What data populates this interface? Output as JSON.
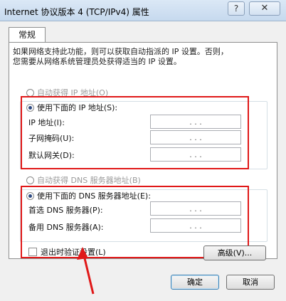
{
  "window": {
    "title": "Internet 协议版本 4 (TCP/IPv4) 属性",
    "help_label": "?",
    "close_label": "✕"
  },
  "tabs": [
    {
      "label": "常规"
    }
  ],
  "description": "如果网络支持此功能，则可以获取自动指派的 IP 设置。否则，\n您需要从网络系统管理员处获得适当的 IP 设置。",
  "ip": {
    "auto_label": "自动获得 IP 地址(O)",
    "manual_label": "使用下面的 IP 地址(S):",
    "selected": "manual",
    "fields": [
      {
        "label": "IP 地址(I):",
        "value": ""
      },
      {
        "label": "子网掩码(U):",
        "value": ""
      },
      {
        "label": "默认网关(D):",
        "value": ""
      }
    ]
  },
  "dns": {
    "auto_label": "自动获得 DNS 服务器地址(B)",
    "manual_label": "使用下面的 DNS 服务器地址(E):",
    "selected": "manual",
    "fields": [
      {
        "label": "首选 DNS 服务器(P):",
        "value": ""
      },
      {
        "label": "备用 DNS 服务器(A):",
        "value": ""
      }
    ]
  },
  "validate_on_exit": {
    "label": "退出时验证设置(L)",
    "checked": false
  },
  "buttons": {
    "advanced": "高级(V)...",
    "ok": "确定",
    "cancel": "取消"
  },
  "ip_dots": ".   .   .",
  "colors": {
    "annotation_red": "#e01818",
    "titlebar": "#c6d9ee"
  }
}
